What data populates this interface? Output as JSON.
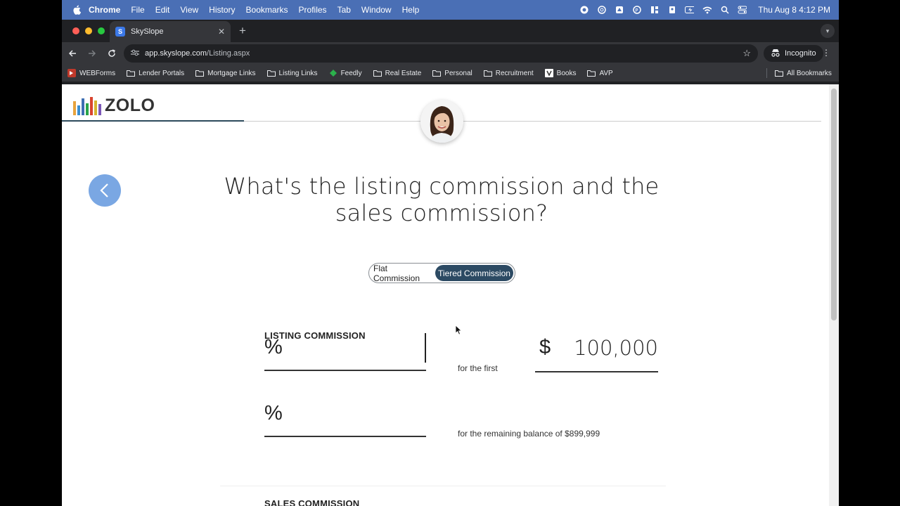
{
  "menubar": {
    "app": "Chrome",
    "items": [
      "File",
      "Edit",
      "View",
      "History",
      "Bookmarks",
      "Profiles",
      "Tab",
      "Window",
      "Help"
    ],
    "clock": "Thu Aug 8  4:12 PM"
  },
  "browser": {
    "tab_title": "SkySlope",
    "url_host": "app.skyslope.com",
    "url_path": "/Listing.aspx",
    "incognito_label": "Incognito",
    "bookmarks": [
      "WEBForms",
      "Lender Portals",
      "Mortgage Links",
      "Listing Links",
      "Feedly",
      "Real Estate",
      "Personal",
      "Recruitment",
      "Books",
      "AVP"
    ],
    "all_bookmarks": "All Bookmarks"
  },
  "page": {
    "logo_text": "ZOLO",
    "question": "What's the listing commission and the sales commission?",
    "toggle": {
      "flat": "Flat Commission",
      "tiered": "Tiered Commission",
      "selected": "Tiered Commission"
    },
    "listing_label": "LISTING COMMISSION",
    "percent_symbol": "%",
    "dollar_symbol": "$",
    "tier1_amount": "100,000",
    "tier1_hint": "for the first",
    "tier2_hint": "for the remaining balance of $899,999",
    "sales_label": "SALES COMMISSION",
    "progress_fraction": 0.24
  },
  "colors": {
    "menubar": "#4a6fb5",
    "accent": "#2c4a63",
    "back_button": "#7aa7e3"
  }
}
